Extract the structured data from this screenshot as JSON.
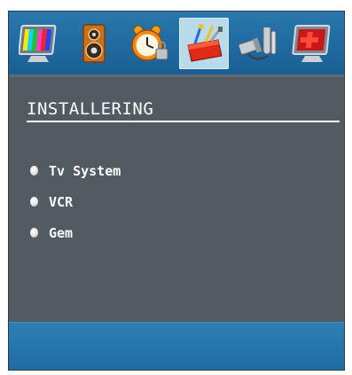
{
  "icons": [
    "picture-icon",
    "sound-icon",
    "clock-lock-icon",
    "toolbox-icon",
    "cable-icon",
    "close-tv-icon"
  ],
  "active_icon": "toolbox-icon",
  "panel": {
    "title": "INSTALLERING",
    "items": [
      {
        "label": "Tv System"
      },
      {
        "label": "VCR"
      },
      {
        "label": "Gem"
      }
    ]
  },
  "colors": {
    "osd_panel": "#525a62",
    "icon_bar": "#1f6aa0",
    "active_icon_bg": "#b9dbe9",
    "footer": "#1f6ca4"
  }
}
